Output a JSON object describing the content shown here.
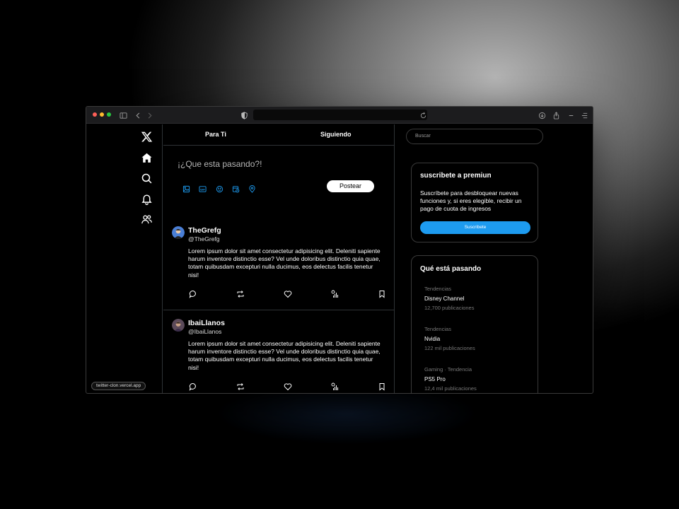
{
  "browser": {
    "traffic_light_colors": [
      "#ff5f57",
      "#febc2e",
      "#28c840"
    ],
    "icons": [
      "sidebar-icon",
      "back-icon",
      "forward-icon",
      "privacy-shield-icon",
      "reload-icon",
      "download-icon",
      "share-icon",
      "minimize-icon",
      "menu-icon"
    ]
  },
  "sidebar": {
    "nav": [
      "x-logo-icon",
      "home-icon",
      "search-icon",
      "notifications-icon",
      "communities-icon"
    ],
    "url_pill": "twitter-clon.vercel.app"
  },
  "feed": {
    "tabs": [
      "Para Ti",
      "Siguiendo"
    ],
    "composer": {
      "placeholder": "¡¿Que esta pasando?!",
      "tools": [
        "image-icon",
        "gif-icon",
        "emoji-icon",
        "schedule-icon",
        "location-icon"
      ],
      "post_label": "Postear"
    },
    "tweets": [
      {
        "name": "TheGrefg",
        "handle": "@TheGrefg",
        "text": "Lorem ipsum dolor sit amet consectetur adipisicing elit. Deleniti sapiente harum inventore distinctio esse? Vel unde doloribus distinctio quia quae, totam quibusdam excepturi nulla ducimus, eos delectus facilis tenetur nisi!",
        "avatar_color": "#4a7fd6"
      },
      {
        "name": "IbaiLlanos",
        "handle": "@IbaiLlanos",
        "text": "Lorem ipsum dolor sit amet consectetur adipisicing elit. Deleniti sapiente harum inventore distinctio esse? Vel unde doloribus distinctio quia quae, totam quibusdam excepturi nulla ducimus, eos delectus facilis tenetur nisi!",
        "avatar_color": "#7a5a6e"
      }
    ],
    "actions": [
      "reply-icon",
      "retweet-icon",
      "like-icon",
      "views-icon",
      "bookmark-icon"
    ]
  },
  "right": {
    "search_placeholder": "Buscar",
    "premium": {
      "title": "suscribete a premiun",
      "body": "Suscríbete para desbloquear nuevas funciones y, si eres elegible, recibir un pago de cuota de ingresos",
      "button": "Suscribete"
    },
    "trends_title": "Qué está pasando",
    "trends": [
      {
        "category": "Tendencias",
        "name": "Disney Channel",
        "count": "12,700 publicaciones"
      },
      {
        "category": "Tendencias",
        "name": "Nvidia",
        "count": "122 mil publicaciones"
      },
      {
        "category": "Gaming · Tendencia",
        "name": "PS5 Pro",
        "count": "12,4 mil publicaciones"
      }
    ]
  },
  "colors": {
    "accent": "#1d9bf0",
    "background": "#000000",
    "border": "#2f3336"
  }
}
